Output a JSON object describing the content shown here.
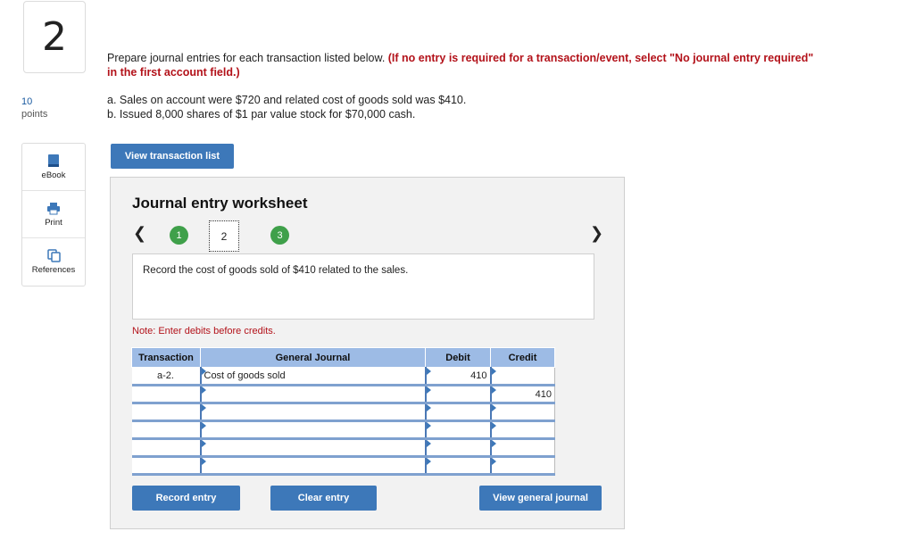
{
  "question": {
    "number": "2",
    "points_value": "10",
    "points_label": "points"
  },
  "sidebar": {
    "items": [
      {
        "label": "eBook",
        "icon": "ebook-icon"
      },
      {
        "label": "Print",
        "icon": "print-icon"
      },
      {
        "label": "References",
        "icon": "references-icon"
      }
    ]
  },
  "prompt": {
    "text": "Prepare journal entries for each transaction listed below. ",
    "emphasis": "(If no entry is required for a transaction/event, select \"No journal entry required\" in the first account field.)"
  },
  "transactions": [
    "a. Sales on account were $720 and related cost of goods sold was $410.",
    "b. Issued 8,000 shares of $1 par value stock for $70,000 cash."
  ],
  "buttons": {
    "view_transaction_list": "View transaction list",
    "record_entry": "Record entry",
    "clear_entry": "Clear entry",
    "view_general_journal": "View general journal"
  },
  "worksheet": {
    "title": "Journal entry worksheet",
    "steps": [
      "1",
      "2",
      "3"
    ],
    "current_step": "2",
    "instruction": "Record the cost of goods sold of $410 related to the sales.",
    "note": "Note: Enter debits before credits.",
    "columns": [
      "Transaction",
      "General Journal",
      "Debit",
      "Credit"
    ],
    "rows": [
      {
        "transaction": "a-2.",
        "account": "Cost of goods sold",
        "debit": "410",
        "credit": ""
      },
      {
        "transaction": "",
        "account": "",
        "debit": "",
        "credit": "410"
      },
      {
        "transaction": "",
        "account": "",
        "debit": "",
        "credit": ""
      },
      {
        "transaction": "",
        "account": "",
        "debit": "",
        "credit": ""
      },
      {
        "transaction": "",
        "account": "",
        "debit": "",
        "credit": ""
      },
      {
        "transaction": "",
        "account": "",
        "debit": "",
        "credit": ""
      }
    ]
  },
  "colors": {
    "accent_blue": "#3d78b9",
    "step_green": "#3fa04a",
    "alert_red": "#b3121a",
    "header_blue": "#9dbbe5"
  }
}
